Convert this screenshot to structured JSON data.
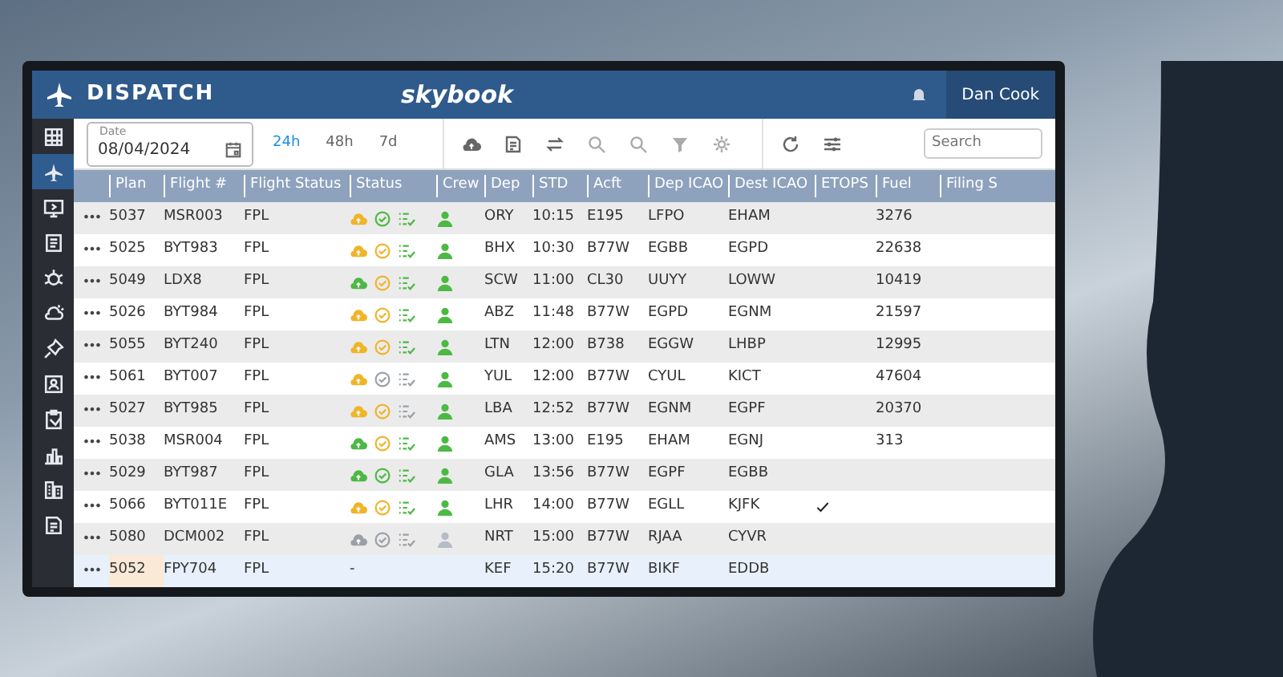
{
  "app": {
    "section_title": "DISPATCH",
    "logo": "skybook",
    "user": "Dan Cook"
  },
  "sidebar": {
    "items": [
      {
        "selected": false
      },
      {
        "selected": true
      },
      {
        "selected": false
      },
      {
        "selected": false
      },
      {
        "selected": false
      },
      {
        "selected": false
      },
      {
        "selected": false
      },
      {
        "selected": false
      },
      {
        "selected": false
      },
      {
        "selected": false
      },
      {
        "selected": false
      },
      {
        "selected": false
      }
    ]
  },
  "toolbar": {
    "date": {
      "label": "Date",
      "value": "08/04/2024"
    },
    "ranges": [
      {
        "label": "24h",
        "selected": true
      },
      {
        "label": "48h",
        "selected": false
      },
      {
        "label": "7d",
        "selected": false
      }
    ],
    "search": {
      "placeholder": "Search"
    }
  },
  "table": {
    "columns": [
      "Plan",
      "Flight #",
      "Flight Status",
      "Status",
      "Crew",
      "Dep",
      "STD",
      "Acft",
      "Dep ICAO",
      "Dest ICAO",
      "ETOPS",
      "Fuel",
      "Filing S"
    ],
    "rows": [
      {
        "actions": "•••",
        "plan": "5037",
        "flight": "MSR003",
        "flight_status": "FPL",
        "status_icons": [
          {
            "kind": "weather",
            "color": "#f0b429"
          },
          {
            "kind": "briefing",
            "color": "#4cb944"
          },
          {
            "kind": "checklist",
            "color": "#4cb944"
          }
        ],
        "crew": {
          "color": "#4cb944"
        },
        "dep": "ORY",
        "std": "10:15",
        "acft": "E195",
        "dep_icao": "LFPO",
        "dest_icao": "EHAM",
        "etops": false,
        "fuel": "3276",
        "selected": false
      },
      {
        "actions": "•••",
        "plan": "5025",
        "flight": "BYT983",
        "flight_status": "FPL",
        "status_icons": [
          {
            "kind": "weather",
            "color": "#f0b429"
          },
          {
            "kind": "briefing",
            "color": "#f0b429"
          },
          {
            "kind": "checklist",
            "color": "#4cb944"
          }
        ],
        "crew": {
          "color": "#4cb944"
        },
        "dep": "BHX",
        "std": "10:30",
        "acft": "B77W",
        "dep_icao": "EGBB",
        "dest_icao": "EGPD",
        "etops": false,
        "fuel": "22638",
        "selected": false
      },
      {
        "actions": "•••",
        "plan": "5049",
        "flight": "LDX8",
        "flight_status": "FPL",
        "status_icons": [
          {
            "kind": "weather",
            "color": "#4cb944"
          },
          {
            "kind": "briefing",
            "color": "#f0b429"
          },
          {
            "kind": "checklist",
            "color": "#4cb944"
          }
        ],
        "crew": {
          "color": "#4cb944"
        },
        "dep": "SCW",
        "std": "11:00",
        "acft": "CL30",
        "dep_icao": "UUYY",
        "dest_icao": "LOWW",
        "etops": false,
        "fuel": "10419",
        "selected": false
      },
      {
        "actions": "•••",
        "plan": "5026",
        "flight": "BYT984",
        "flight_status": "FPL",
        "status_icons": [
          {
            "kind": "weather",
            "color": "#f0b429"
          },
          {
            "kind": "briefing",
            "color": "#f0b429"
          },
          {
            "kind": "checklist",
            "color": "#4cb944"
          }
        ],
        "crew": {
          "color": "#4cb944"
        },
        "dep": "ABZ",
        "std": "11:48",
        "acft": "B77W",
        "dep_icao": "EGPD",
        "dest_icao": "EGNM",
        "etops": false,
        "fuel": "21597",
        "selected": false
      },
      {
        "actions": "•••",
        "plan": "5055",
        "flight": "BYT240",
        "flight_status": "FPL",
        "status_icons": [
          {
            "kind": "weather",
            "color": "#f0b429"
          },
          {
            "kind": "briefing",
            "color": "#f0b429"
          },
          {
            "kind": "checklist",
            "color": "#4cb944"
          }
        ],
        "crew": {
          "color": "#4cb944"
        },
        "dep": "LTN",
        "std": "12:00",
        "acft": "B738",
        "dep_icao": "EGGW",
        "dest_icao": "LHBP",
        "etops": false,
        "fuel": "12995",
        "selected": false
      },
      {
        "actions": "•••",
        "plan": "5061",
        "flight": "BYT007",
        "flight_status": "FPL",
        "status_icons": [
          {
            "kind": "weather",
            "color": "#f0b429"
          },
          {
            "kind": "briefing",
            "color": "#9aa0a6"
          },
          {
            "kind": "checklist",
            "color": "#9aa0a6"
          }
        ],
        "crew": {
          "color": "#4cb944"
        },
        "dep": "YUL",
        "std": "12:00",
        "acft": "B77W",
        "dep_icao": "CYUL",
        "dest_icao": "KICT",
        "etops": false,
        "fuel": "47604",
        "selected": false
      },
      {
        "actions": "•••",
        "plan": "5027",
        "flight": "BYT985",
        "flight_status": "FPL",
        "status_icons": [
          {
            "kind": "weather",
            "color": "#f0b429"
          },
          {
            "kind": "briefing",
            "color": "#f0b429"
          },
          {
            "kind": "checklist",
            "color": "#9aa0a6"
          }
        ],
        "crew": {
          "color": "#4cb944"
        },
        "dep": "LBA",
        "std": "12:52",
        "acft": "B77W",
        "dep_icao": "EGNM",
        "dest_icao": "EGPF",
        "etops": false,
        "fuel": "20370",
        "selected": false
      },
      {
        "actions": "•••",
        "plan": "5038",
        "flight": "MSR004",
        "flight_status": "FPL",
        "status_icons": [
          {
            "kind": "weather",
            "color": "#4cb944"
          },
          {
            "kind": "briefing",
            "color": "#f0b429"
          },
          {
            "kind": "checklist",
            "color": "#4cb944"
          }
        ],
        "crew": {
          "color": "#4cb944"
        },
        "dep": "AMS",
        "std": "13:00",
        "acft": "E195",
        "dep_icao": "EHAM",
        "dest_icao": "EGNJ",
        "etops": false,
        "fuel": "313",
        "selected": false
      },
      {
        "actions": "•••",
        "plan": "5029",
        "flight": "BYT987",
        "flight_status": "FPL",
        "status_icons": [
          {
            "kind": "weather",
            "color": "#4cb944"
          },
          {
            "kind": "briefing",
            "color": "#4cb944"
          },
          {
            "kind": "checklist",
            "color": "#4cb944"
          }
        ],
        "crew": {
          "color": "#4cb944"
        },
        "dep": "GLA",
        "std": "13:56",
        "acft": "B77W",
        "dep_icao": "EGPF",
        "dest_icao": "EGBB",
        "etops": false,
        "selected": false
      },
      {
        "actions": "•••",
        "plan": "5066",
        "flight": "BYT011E",
        "flight_status": "FPL",
        "status_icons": [
          {
            "kind": "weather",
            "color": "#f0b429"
          },
          {
            "kind": "briefing",
            "color": "#f0b429"
          },
          {
            "kind": "checklist",
            "color": "#4cb944"
          }
        ],
        "crew": {
          "color": "#4cb944"
        },
        "dep": "LHR",
        "std": "14:00",
        "acft": "B77W",
        "dep_icao": "EGLL",
        "dest_icao": "KJFK",
        "etops": true,
        "selected": false
      },
      {
        "actions": "•••",
        "plan": "5080",
        "flight": "DCM002",
        "flight_status": "FPL",
        "status_icons": [
          {
            "kind": "weather",
            "color": "#9aa0a6"
          },
          {
            "kind": "briefing",
            "color": "#9aa0a6"
          },
          {
            "kind": "checklist",
            "color": "#9aa0a6"
          }
        ],
        "crew": {
          "color": "#b5bcc5"
        },
        "dep": "NRT",
        "std": "15:00",
        "acft": "B77W",
        "dep_icao": "RJAA",
        "dest_icao": "CYVR",
        "etops": false,
        "selected": false
      },
      {
        "actions": "•••",
        "plan": "5052",
        "flight": "FPY704",
        "flight_status": "FPL",
        "status_text": "-",
        "dep": "KEF",
        "std": "15:20",
        "acft": "B77W",
        "dep_icao": "BIKF",
        "dest_icao": "EDDB",
        "etops": false,
        "selected": true
      }
    ]
  }
}
